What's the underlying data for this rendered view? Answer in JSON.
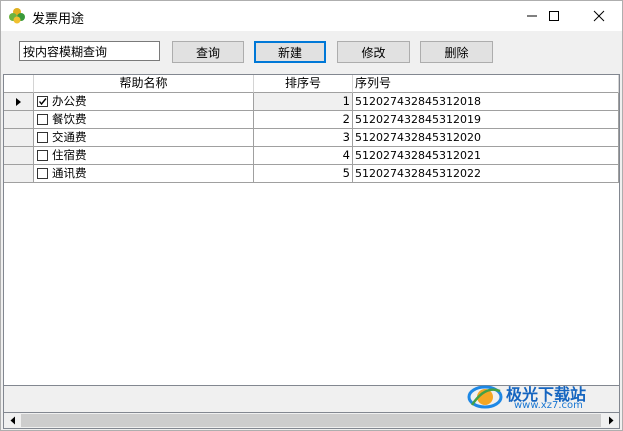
{
  "window": {
    "title": "发票用途"
  },
  "toolbar": {
    "search_value": "按内容模糊查询",
    "query_label": "查询",
    "new_label": "新建",
    "edit_label": "修改",
    "delete_label": "删除"
  },
  "grid": {
    "columns": [
      "帮助名称",
      "排序号",
      "序列号"
    ],
    "rows": [
      {
        "checked": true,
        "name": "办公费",
        "order": "1",
        "serial": "512027432845312018"
      },
      {
        "checked": false,
        "name": "餐饮费",
        "order": "2",
        "serial": "512027432845312019"
      },
      {
        "checked": false,
        "name": "交通费",
        "order": "3",
        "serial": "512027432845312020"
      },
      {
        "checked": false,
        "name": "住宿费",
        "order": "4",
        "serial": "512027432845312021"
      },
      {
        "checked": false,
        "name": "通讯费",
        "order": "5",
        "serial": "512027432845312022"
      }
    ]
  },
  "watermark": {
    "text": "极光下载站",
    "url": "www.xz7.com"
  }
}
